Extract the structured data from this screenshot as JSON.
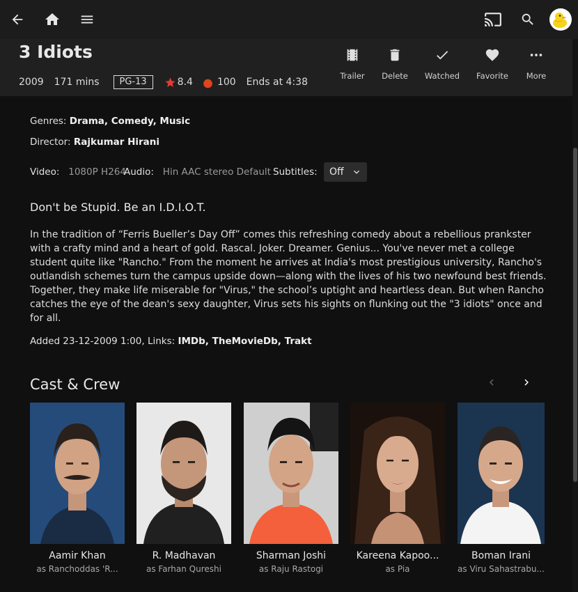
{
  "topbar": {
    "back_icon": "arrow-left-icon",
    "home_icon": "home-icon",
    "menu_icon": "hamburger-icon",
    "cast_icon": "cast-icon",
    "search_icon": "search-icon",
    "avatar_icon": "duck-avatar"
  },
  "movie": {
    "title": "3 Idiots",
    "year": "2009",
    "runtime": "171 mins",
    "rating": "PG-13",
    "community_rating": "8.4",
    "critic_rating": "100",
    "ends_at": "Ends at 4:38"
  },
  "actions": {
    "trailer": "Trailer",
    "delete": "Delete",
    "watched": "Watched",
    "favorite": "Favorite",
    "more": "More"
  },
  "details": {
    "genres_label": "Genres:",
    "genres": "Drama, Comedy, Music",
    "director_label": "Director:",
    "director": "Rajkumar Hirani",
    "video_label": "Video:",
    "video": "1080P H264",
    "audio_label": "Audio:",
    "audio": "Hin AAC stereo Default",
    "subtitles_label": "Subtitles:",
    "subtitles_value": "Off",
    "tagline": "Don't be Stupid. Be an I.D.I.O.T.",
    "overview": "In the tradition of “Ferris Bueller’s Day Off” comes this refreshing comedy about a rebellious prankster with a crafty mind and a heart of gold. Rascal. Joker. Dreamer. Genius... You've never met a college student quite like \"Rancho.\" From the moment he arrives at India's most prestigious university, Rancho's outlandish schemes turn the campus upside down—along with the lives of his two newfound best friends. Together, they make life miserable for \"Virus,\" the school’s uptight and heartless dean. But when Rancho catches the eye of the dean's sexy daughter, Virus sets his sights on flunking out the \"3 idiots\" once and for all.",
    "added": "Added 23-12-2009 1:00, Links: ",
    "links": [
      "IMDb",
      "TheMovieDb",
      "Trakt"
    ]
  },
  "cast_section": {
    "title": "Cast & Crew",
    "members": [
      {
        "name": "Aamir Khan",
        "role": "as Ranchoddas 'R..."
      },
      {
        "name": "R. Madhavan",
        "role": "as Farhan Qureshi"
      },
      {
        "name": "Sharman Joshi",
        "role": "as Raju Rastogi"
      },
      {
        "name": "Kareena Kapoo...",
        "role": "as Pia"
      },
      {
        "name": "Boman Irani",
        "role": "as Viru Sahastrabu..."
      }
    ]
  },
  "colors": {
    "star": "#e53935",
    "tomato": "#e3421d",
    "background": "#101010",
    "header": "#202020"
  }
}
